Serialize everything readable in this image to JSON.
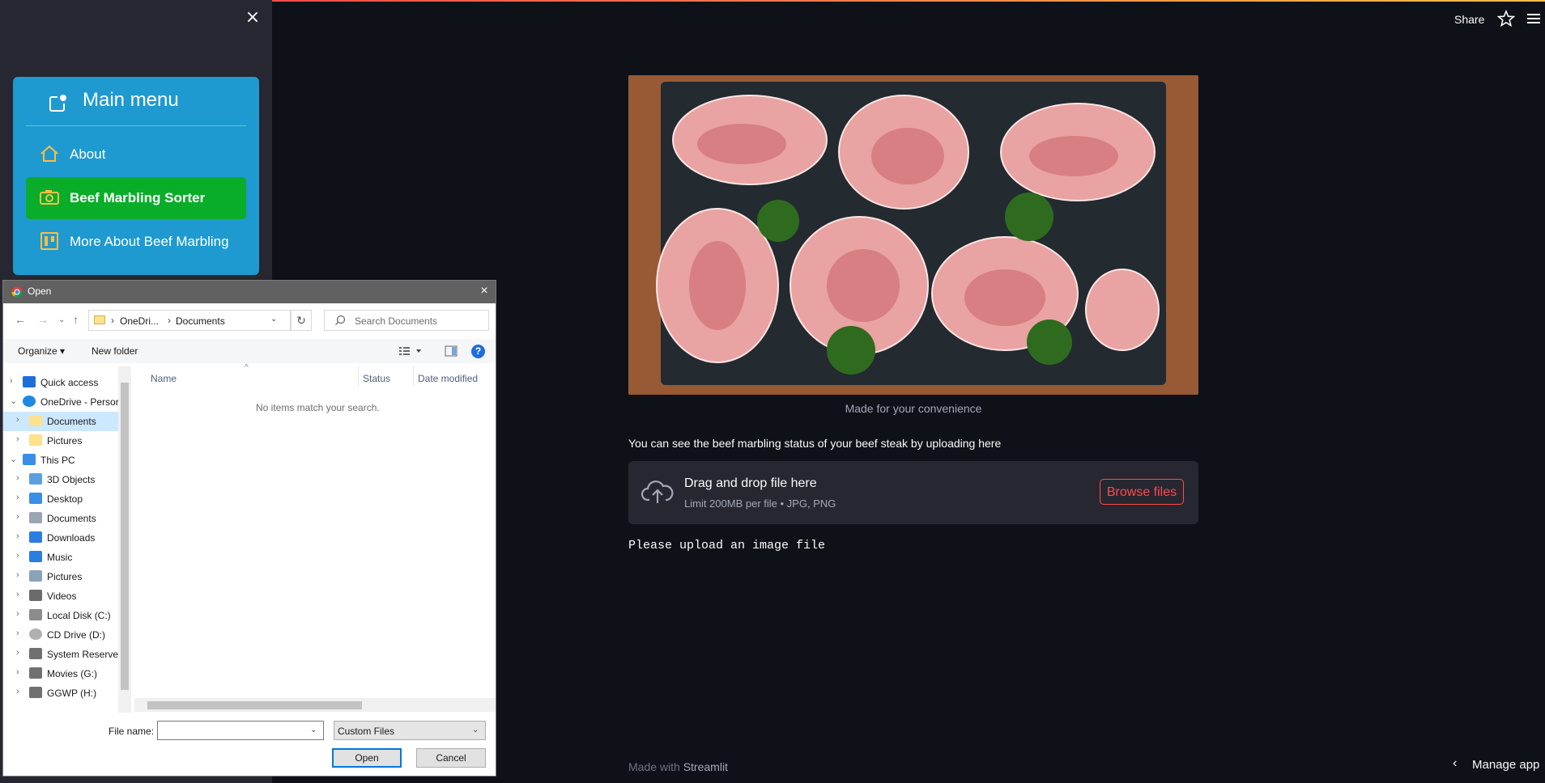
{
  "sidebar": {
    "close_icon": "×",
    "menu_title": "Main menu",
    "items": [
      {
        "label": "About",
        "icon": "house-icon"
      },
      {
        "label": "Beef Marbling Sorter",
        "icon": "camera-icon",
        "selected": true
      },
      {
        "label": "More About Beef Marbling",
        "icon": "kanban-icon"
      }
    ],
    "card_color": "#1e9ad0",
    "selected_color": "#0aad2a"
  },
  "header": {
    "share_label": "Share",
    "star_icon": "star-icon",
    "menu_icon": "hamburger-icon"
  },
  "main": {
    "image_caption": "Made for your convenience",
    "upload_prompt": "You can see the beef marbling status of your beef steak by uploading here",
    "dropzone_title": "Drag and drop file here",
    "dropzone_limit": "Limit 200MB per file • JPG, PNG",
    "browse_label": "Browse files",
    "status_text": "Please upload an image file",
    "accent_color": "#ff4b4b"
  },
  "footer": {
    "made_with": "Made with",
    "brand": "Streamlit",
    "manage_chevron": "‹",
    "manage_label": "Manage app"
  },
  "dialog": {
    "title": "Open",
    "close_icon": "×",
    "address": {
      "segment1": "OneDri...",
      "segment2": "Documents"
    },
    "search_placeholder": "Search Documents",
    "organize_label": "Organize ▾",
    "new_folder_label": "New folder",
    "help_label": "?",
    "tree": [
      {
        "label": "Quick access",
        "icon": "star-icon",
        "level": 0,
        "expander": "›"
      },
      {
        "label": "OneDrive - Persor",
        "icon": "cloud-icon",
        "level": 0,
        "expander": "⌄"
      },
      {
        "label": "Documents",
        "icon": "folder-icon",
        "level": 1,
        "expander": "›",
        "selected": true
      },
      {
        "label": "Pictures",
        "icon": "folder-icon",
        "level": 1,
        "expander": "›"
      },
      {
        "label": "This PC",
        "icon": "computer-icon",
        "level": 0,
        "expander": "⌄"
      },
      {
        "label": "3D Objects",
        "icon": "cube-icon",
        "level": 1,
        "expander": "›"
      },
      {
        "label": "Desktop",
        "icon": "desktop-icon",
        "level": 1,
        "expander": "›"
      },
      {
        "label": "Documents",
        "icon": "document-icon",
        "level": 1,
        "expander": "›"
      },
      {
        "label": "Downloads",
        "icon": "download-icon",
        "level": 1,
        "expander": "›"
      },
      {
        "label": "Music",
        "icon": "music-icon",
        "level": 1,
        "expander": "›"
      },
      {
        "label": "Pictures",
        "icon": "picture-icon",
        "level": 1,
        "expander": "›"
      },
      {
        "label": "Videos",
        "icon": "video-icon",
        "level": 1,
        "expander": "›"
      },
      {
        "label": "Local Disk (C:)",
        "icon": "disk-icon",
        "level": 1,
        "expander": "›"
      },
      {
        "label": "CD Drive (D:)",
        "icon": "cd-icon",
        "level": 1,
        "expander": "›"
      },
      {
        "label": "System Reserved",
        "icon": "drive-icon",
        "level": 1,
        "expander": "›"
      },
      {
        "label": "Movies (G:)",
        "icon": "drive-icon",
        "level": 1,
        "expander": "›"
      },
      {
        "label": "GGWP (H:)",
        "icon": "drive-icon",
        "level": 1,
        "expander": "›"
      }
    ],
    "columns": [
      "Name",
      "Status",
      "Date modified"
    ],
    "empty_message": "No items match your search.",
    "filename_label": "File name:",
    "filename_value": "",
    "filetype_value": "Custom Files",
    "open_label": "Open",
    "cancel_label": "Cancel"
  }
}
